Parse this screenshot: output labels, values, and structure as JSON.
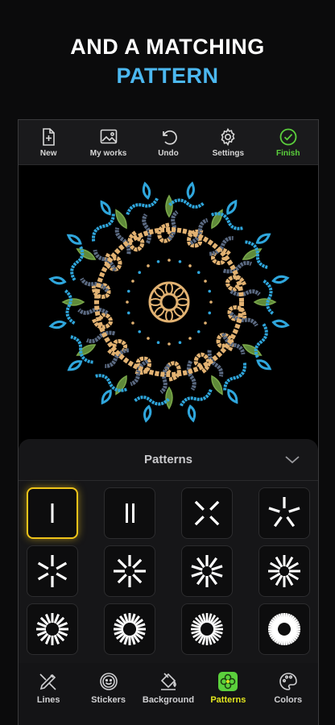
{
  "headline": {
    "line1": "AND A MATCHING",
    "line2": "PATTERN"
  },
  "toolbar": {
    "items": [
      {
        "label": "New",
        "icon": "new-file-icon"
      },
      {
        "label": "My works",
        "icon": "image-gallery-icon"
      },
      {
        "label": "Undo",
        "icon": "undo-icon"
      },
      {
        "label": "Settings",
        "icon": "gear-icon"
      },
      {
        "label": "Finish",
        "icon": "check-circle-icon"
      }
    ],
    "finish_color": "#5bd03c"
  },
  "sheet": {
    "title": "Patterns",
    "selected_index": 0,
    "patterns": [
      {
        "rays": 1,
        "icon": "pattern-1-ray-icon"
      },
      {
        "rays": 2,
        "icon": "pattern-2-rays-icon"
      },
      {
        "rays": 4,
        "icon": "pattern-4-rays-icon"
      },
      {
        "rays": 5,
        "icon": "pattern-5-rays-icon"
      },
      {
        "rays": 6,
        "icon": "pattern-6-rays-icon"
      },
      {
        "rays": 8,
        "icon": "pattern-8-rays-icon"
      },
      {
        "rays": 10,
        "icon": "pattern-10-rays-icon"
      },
      {
        "rays": 12,
        "icon": "pattern-12-rays-icon"
      },
      {
        "rays": 16,
        "icon": "pattern-16-rays-icon"
      },
      {
        "rays": 20,
        "icon": "pattern-20-rays-icon"
      },
      {
        "rays": 24,
        "icon": "pattern-24-rays-icon"
      },
      {
        "rays": 40,
        "icon": "pattern-40-rays-icon"
      }
    ],
    "selected_color": "#f0c419"
  },
  "tabbar": {
    "items": [
      {
        "label": "Lines",
        "icon": "brush-ruler-icon"
      },
      {
        "label": "Stickers",
        "icon": "smiley-sticker-icon"
      },
      {
        "label": "Background",
        "icon": "paint-bucket-icon"
      },
      {
        "label": "Patterns",
        "icon": "pattern-flower-icon"
      },
      {
        "label": "Colors",
        "icon": "palette-icon"
      }
    ],
    "active_index": 3,
    "active_color": "#e2e51f"
  },
  "colors": {
    "accent_blue": "#4cb8f0",
    "mandala_gold": "#e2b272",
    "mandala_slate": "#5b6a82",
    "mandala_green": "#5f8a3a",
    "mandala_blue": "#2fa6dc"
  }
}
